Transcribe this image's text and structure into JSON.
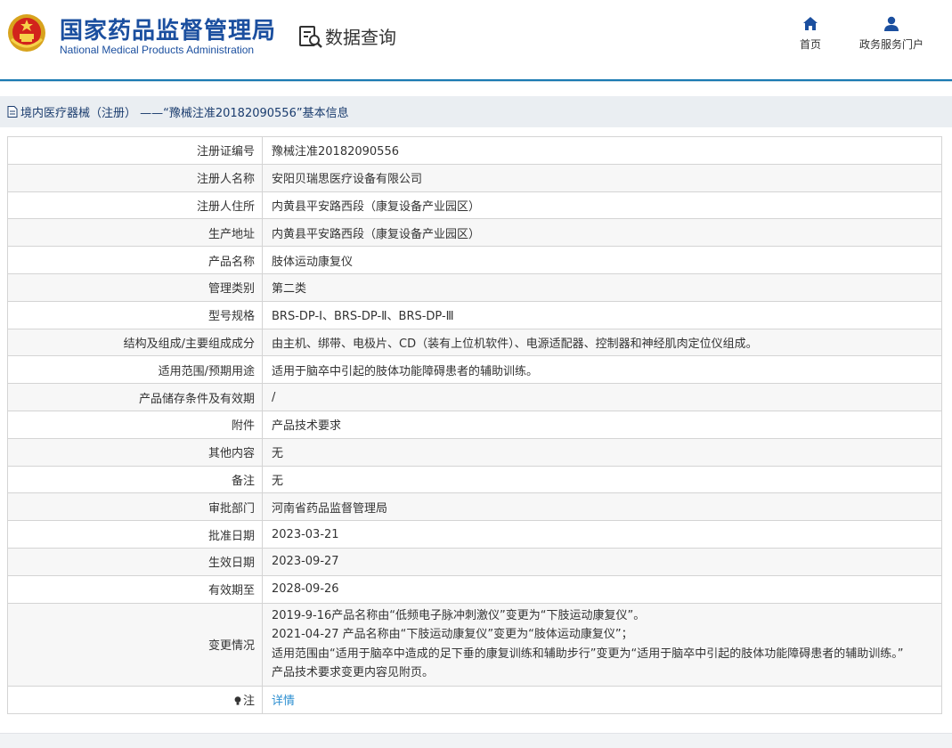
{
  "header": {
    "agency_cn": "国家药品监督管理局",
    "agency_en": "National Medical Products Administration",
    "section_title": "数据查询",
    "nav": {
      "home": "首页",
      "portal": "政务服务门户"
    }
  },
  "breadcrumb": "境内医疗器械（注册） ——“豫械注准20182090556”基本信息",
  "rows": [
    {
      "label": "注册证编号",
      "value": "豫械注准20182090556"
    },
    {
      "label": "注册人名称",
      "value": "安阳贝瑞思医疗设备有限公司"
    },
    {
      "label": "注册人住所",
      "value": "内黄县平安路西段（康复设备产业园区）"
    },
    {
      "label": "生产地址",
      "value": "内黄县平安路西段（康复设备产业园区）"
    },
    {
      "label": "产品名称",
      "value": "肢体运动康复仪"
    },
    {
      "label": "管理类别",
      "value": "第二类"
    },
    {
      "label": "型号规格",
      "value": "BRS-DP-Ⅰ、BRS-DP-Ⅱ、BRS-DP-Ⅲ"
    },
    {
      "label": "结构及组成/主要组成成分",
      "value": "由主机、绑带、电极片、CD（装有上位机软件）、电源适配器、控制器和神经肌肉定位仪组成。"
    },
    {
      "label": "适用范围/预期用途",
      "value": "适用于脑卒中引起的肢体功能障碍患者的辅助训练。"
    },
    {
      "label": "产品储存条件及有效期",
      "value": "/"
    },
    {
      "label": "附件",
      "value": "产品技术要求"
    },
    {
      "label": "其他内容",
      "value": "无"
    },
    {
      "label": "备注",
      "value": "无"
    },
    {
      "label": "审批部门",
      "value": "河南省药品监督管理局"
    },
    {
      "label": "批准日期",
      "value": "2023-03-21"
    },
    {
      "label": "生效日期",
      "value": "2023-09-27"
    },
    {
      "label": "有效期至",
      "value": "2028-09-26"
    }
  ],
  "change": {
    "label": "变更情况",
    "lines": [
      "2019-9-16产品名称由“低频电子脉冲刺激仪”变更为“下肢运动康复仪”。",
      "2021-04-27 产品名称由“下肢运动康复仪”变更为“肢体运动康复仪”；",
      "适用范围由“适用于脑卒中造成的足下垂的康复训练和辅助步行”变更为“适用于脑卒中引起的肢体功能障碍患者的辅助训练。”",
      "产品技术要求变更内容见附页。"
    ]
  },
  "note": {
    "label": "注",
    "link": "详情"
  },
  "colors": {
    "brand_blue": "#1b4f9f",
    "link_blue": "#2d8fd1",
    "rule": "#1a7ab2"
  },
  "icons": {
    "emblem": "national-emblem-icon",
    "query": "data-query-icon",
    "home": "home-icon",
    "portal": "user-icon",
    "doc": "document-icon",
    "bulb": "lightbulb-icon"
  }
}
